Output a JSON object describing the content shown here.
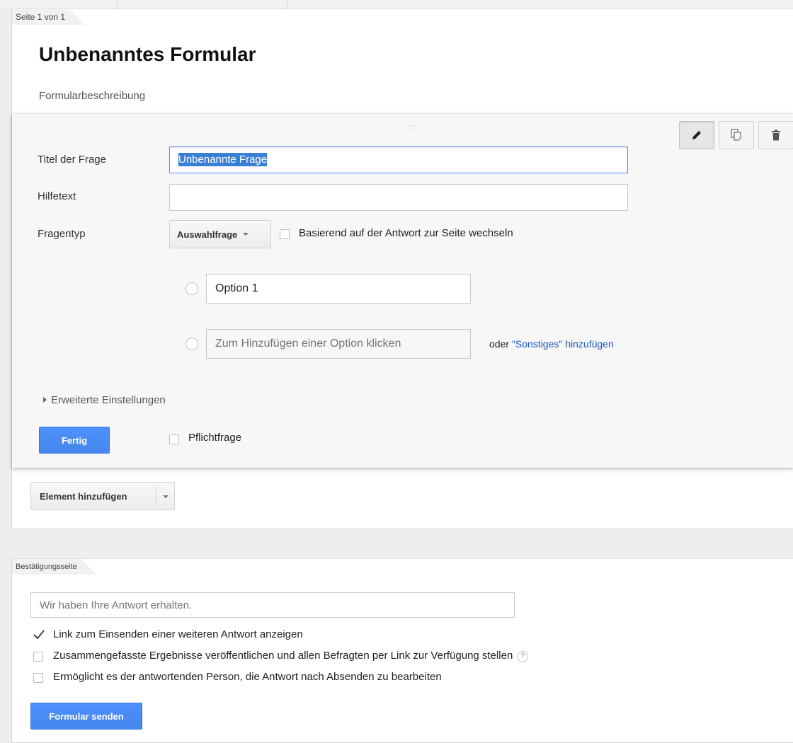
{
  "page": {
    "tab_label": "Seite 1 von 1",
    "form_title": "Unbenanntes Formular",
    "form_description": "Formularbeschreibung"
  },
  "question": {
    "drag_handle": "::::::",
    "title_label": "Titel der Frage",
    "title_value": "Unbenannte Frage",
    "help_label": "Hilfetext",
    "help_value": "",
    "type_label": "Fragentyp",
    "type_value": "Auswahlfrage",
    "branch_checkbox_label": "Basierend auf der Antwort zur Seite wechseln",
    "branch_checked": false,
    "options": [
      {
        "value": "Option 1"
      }
    ],
    "add_option_placeholder": "Zum Hinzufügen einer Option klicken",
    "other_prefix": "oder ",
    "other_link": "\"Sonstiges\" hinzufügen",
    "advanced_settings": "Erweiterte Einstellungen",
    "done_button": "Fertig",
    "required_label": "Pflichtfrage",
    "required_checked": false,
    "actions": [
      "edit-icon",
      "duplicate-icon",
      "delete-icon"
    ]
  },
  "add_element": {
    "label": "Element hinzufügen"
  },
  "confirmation": {
    "tab_label": "Bestätigungsseite",
    "message_placeholder": "Wir haben Ihre Antwort erhalten.",
    "options": [
      {
        "label": "Link zum Einsenden einer weiteren Antwort anzeigen",
        "checked": true
      },
      {
        "label": "Zusammengefasste Ergebnisse veröffentlichen und allen Befragten per Link zur Verfügung stellen",
        "checked": false,
        "help": "?"
      },
      {
        "label": "Ermöglicht es der antwortenden Person, die Antwort nach Absenden zu bearbeiten",
        "checked": false
      }
    ],
    "submit_button": "Formular senden"
  },
  "colors": {
    "accent_blue": "#4d90fe",
    "link_blue": "#1a57c4",
    "selection": "#3a7fd6"
  }
}
